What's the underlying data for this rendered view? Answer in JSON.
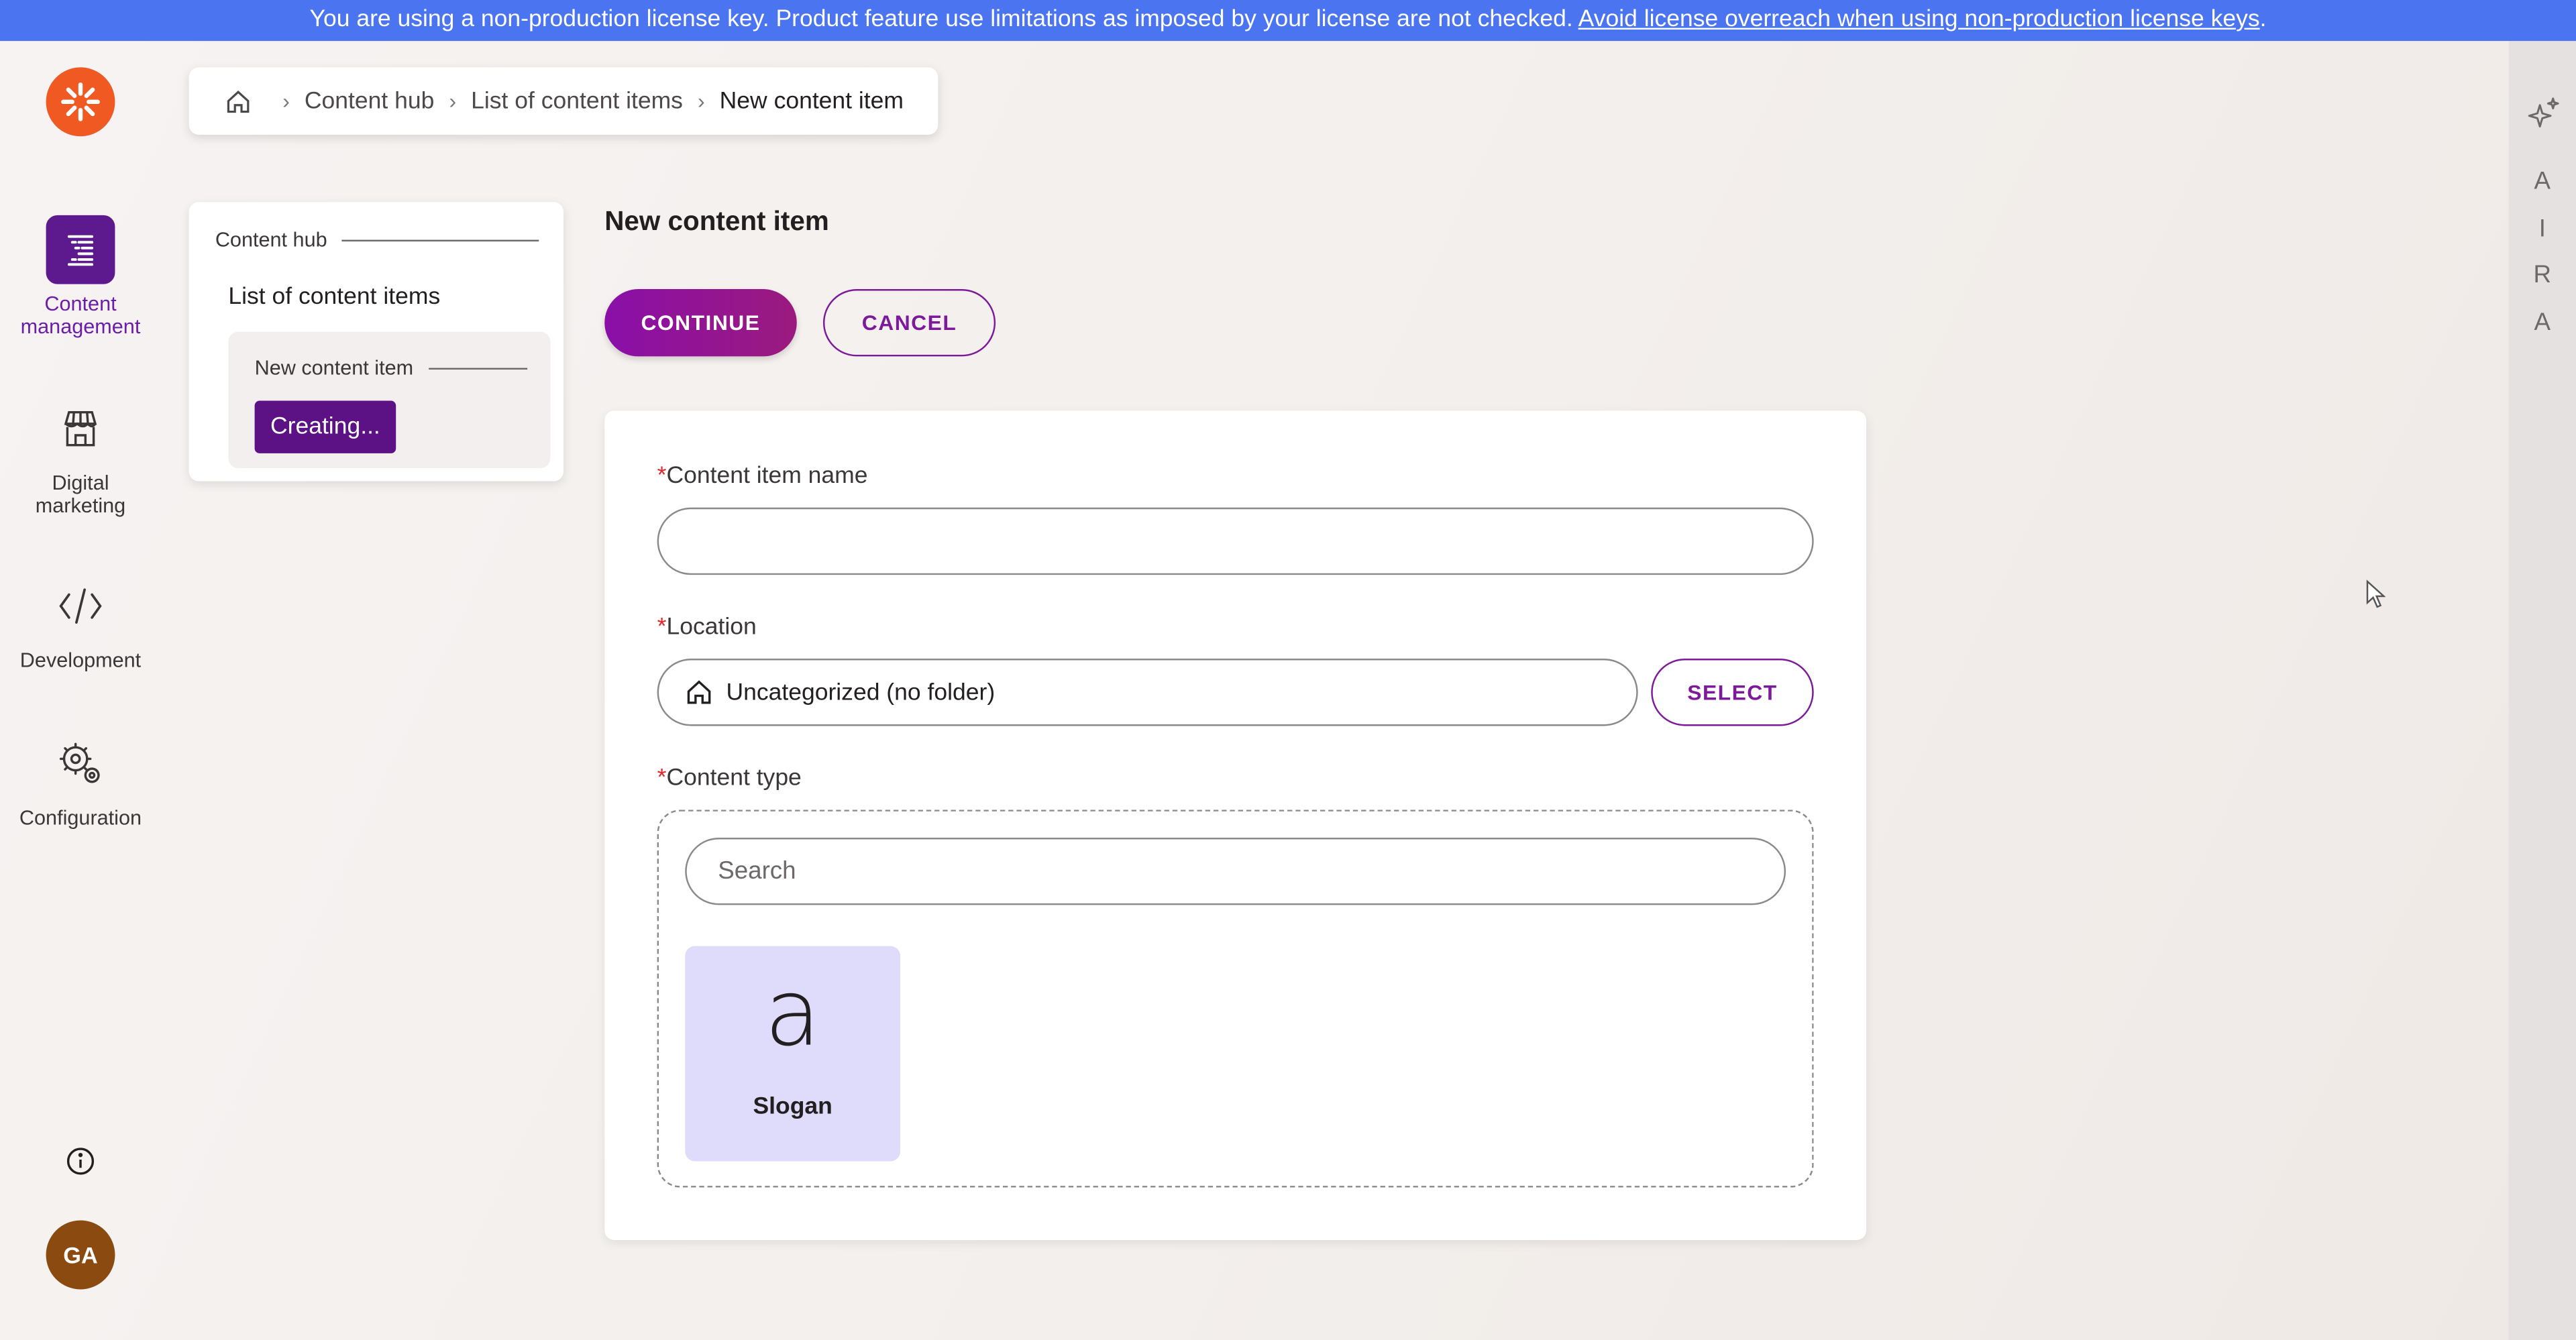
{
  "license_bar": {
    "text": "You are using a non-production license key. Product feature use limitations as imposed by your license are not checked.",
    "link_text": "Avoid license overreach when using non-production license keys",
    "trailing": "."
  },
  "nav": {
    "items": [
      {
        "label": "Content management",
        "icon": "content-management-icon",
        "active": true
      },
      {
        "label": "Digital marketing",
        "icon": "storefront-icon",
        "active": false
      },
      {
        "label": "Development",
        "icon": "code-icon",
        "active": false
      },
      {
        "label": "Configuration",
        "icon": "gear-icon",
        "active": false
      }
    ],
    "avatar_initials": "GA"
  },
  "breadcrumb": {
    "items": [
      "Content hub",
      "List of content items",
      "New content item"
    ]
  },
  "tree": {
    "root": "Content hub",
    "list": "List of content items",
    "child": "New content item",
    "badge": "Creating..."
  },
  "page": {
    "title": "New content item",
    "continue_label": "CONTINUE",
    "cancel_label": "CANCEL"
  },
  "form": {
    "required_mark": "*",
    "name_label": "Content item name",
    "name_value": "",
    "location_label": "Location",
    "location_value": "Uncategorized (no folder)",
    "select_label": "SELECT",
    "type_label": "Content type",
    "search_placeholder": "Search",
    "types": [
      {
        "glyph": "a",
        "name": "Slogan"
      }
    ]
  },
  "aira": {
    "letters": [
      "A",
      "I",
      "R",
      "A"
    ]
  },
  "colors": {
    "accent": "#7d1a9a",
    "license_bar": "#4a74f0",
    "logo": "#f05a22",
    "type_tile": "#dedcfa"
  }
}
